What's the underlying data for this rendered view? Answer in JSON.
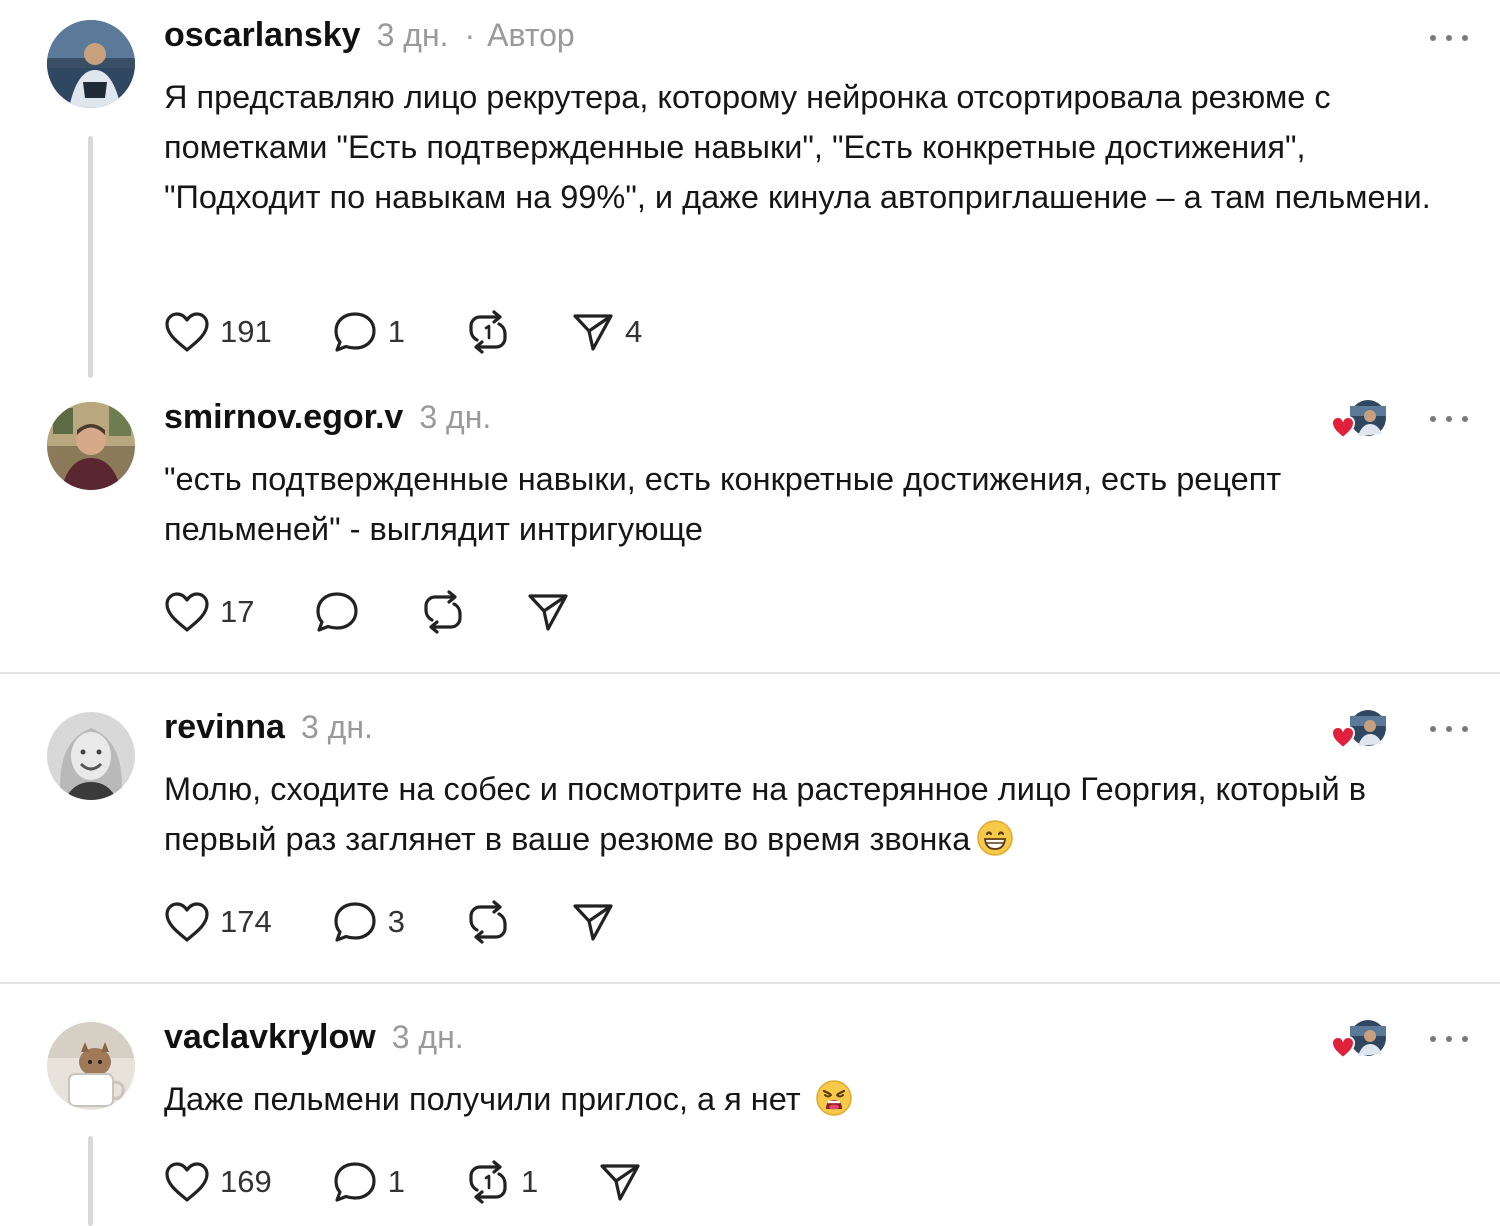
{
  "posts": [
    {
      "username": "oscarlansky",
      "time": "3 дн.",
      "separator": "·",
      "author_label": "Автор",
      "text": "Я представляю лицо рекрутера, которому нейронка отсортировала резюме с пометками \"Есть подтвержденные навыки\", \"Есть конкретные достижения\", \"Подходит по навыкам на 99%\", и даже кинула автоприглашение – а там пельмени.",
      "likes": "191",
      "replies": "1",
      "reposts": "",
      "shares": "4"
    },
    {
      "username": "smirnov.egor.v",
      "time": "3 дн.",
      "text": "\"есть подтвержденные навыки, есть конкретные достижения, есть рецепт пельменей\" - выглядит интригующе",
      "likes": "17",
      "replies": "",
      "reposts": "",
      "shares": ""
    },
    {
      "username": "revinna",
      "time": "3 дн.",
      "text": "Молю, сходите на собес и посмотрите на растерянное лицо Георгия, который в первый раз заглянет в ваше резюме во время звонка",
      "emoji": "grinning-face-with-smiling-eyes",
      "likes": "174",
      "replies": "3",
      "reposts": "",
      "shares": ""
    },
    {
      "username": "vaclavkrylow",
      "time": "3 дн.",
      "text": "Даже пельмени получили приглос, а я нет",
      "emoji": "weary-face",
      "likes": "169",
      "replies": "1",
      "reposts": "1",
      "shares": ""
    }
  ],
  "colors": {
    "like_red": "#e0213b",
    "meta_gray": "#9a9a9a",
    "divider": "#e3e3e3",
    "thread_line": "#d9d9d9"
  },
  "icons": [
    "heart-icon",
    "comment-icon",
    "repost-icon",
    "share-icon",
    "more-icon",
    "liked-by-author-icon"
  ]
}
